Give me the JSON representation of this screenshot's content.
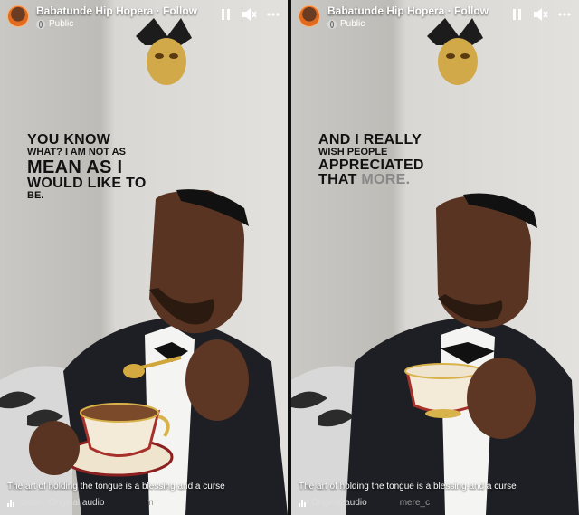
{
  "post": {
    "author": "Babatunde Hip Hopera · Follow",
    "privacy": "Public"
  },
  "panels": [
    {
      "overlay_lines": [
        {
          "text": "YOU KNOW",
          "size": "big"
        },
        {
          "text": "WHAT? I AM NOT AS",
          "size": "small"
        },
        {
          "text": "MEAN AS I",
          "size": "big"
        },
        {
          "text": "WOULD LIKE TO",
          "size": "big"
        },
        {
          "text": "BE.",
          "size": "small"
        }
      ],
      "caption": "The art of holding the tongue is a blessing and a curse",
      "audio": "cisco · Original audio",
      "audio_tail": "m"
    },
    {
      "overlay_lines": [
        {
          "text": "AND I REALLY",
          "size": "big"
        },
        {
          "text": "WISH PEOPLE",
          "size": "small"
        },
        {
          "text": "APPRECIATED",
          "size": "big"
        },
        {
          "text": "THAT",
          "size": "big",
          "gray": "MORE."
        }
      ],
      "caption": "The art of holding the tongue is a blessing and a curse",
      "audio": "Original audio",
      "audio_tail": "mere_c"
    }
  ],
  "icons": [
    "pause-icon",
    "volume-muted-icon",
    "more-icon",
    "globe-icon",
    "sound-icon"
  ],
  "colors": {
    "overlay_text": "#111111",
    "gray_text": "#888888",
    "avatar_ring": "#e06a1e"
  }
}
